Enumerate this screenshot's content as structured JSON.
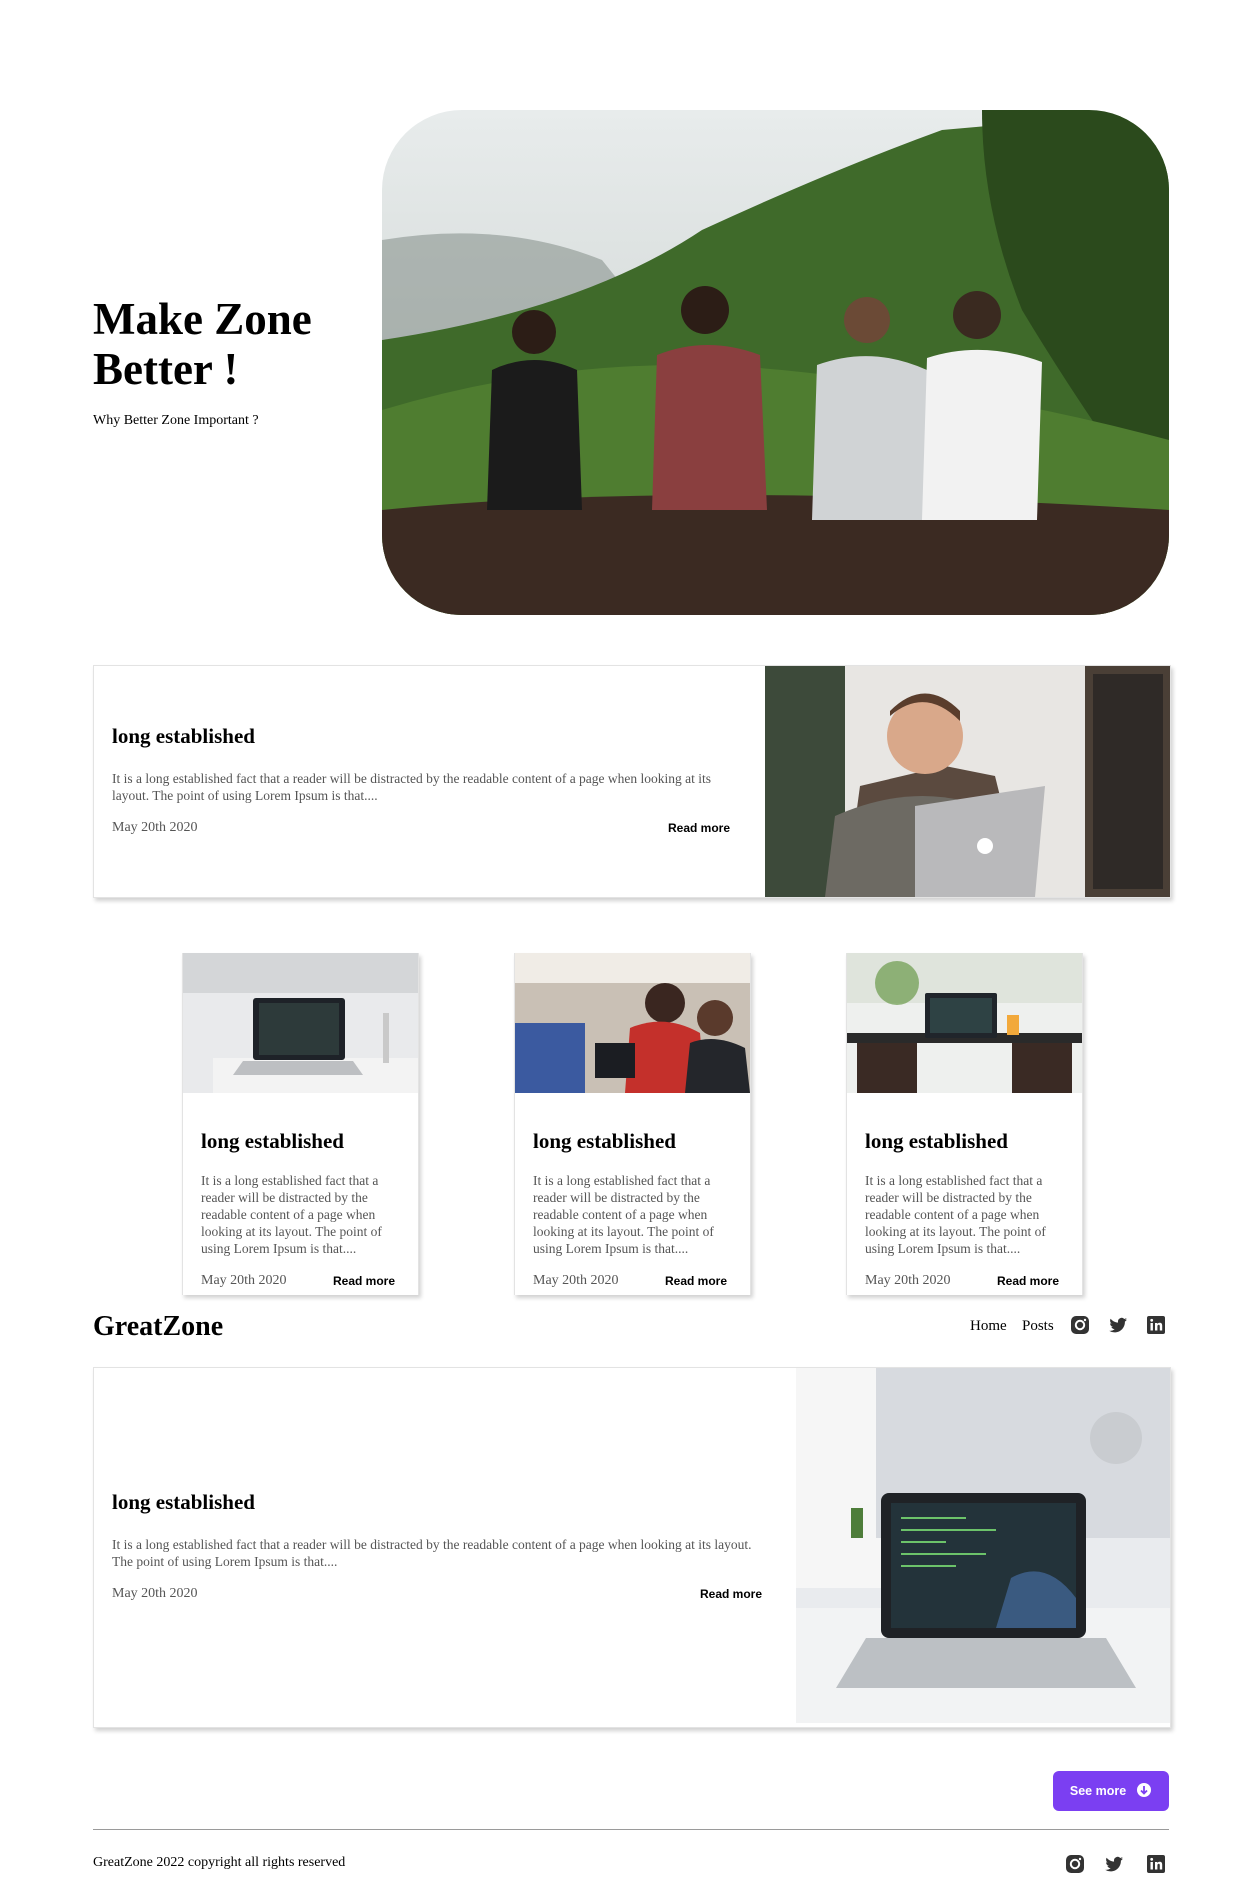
{
  "hero": {
    "title": "Make Zone Better !",
    "subtitle": "Why Better Zone Important ?",
    "image": "group of four men sitting on green mountain ridge"
  },
  "featured_post": {
    "title": "long established",
    "text": "It is a long established fact that a reader will be distracted by the readable content of a page when looking at its layout. The point of using Lorem Ipsum is that....",
    "date": "May 20th 2020",
    "read_more": "Read more",
    "image": "man with beard using laptop"
  },
  "posts": [
    {
      "title": "long established",
      "text": "It is a long established fact that a reader will be distracted by the readable content of a page when looking at its layout. The point of using Lorem Ipsum is that....",
      "date": "May 20th 2020",
      "read_more": "Read more",
      "image": "laptop on white desk"
    },
    {
      "title": "long established",
      "text": "It is a long established fact that a reader will be distracted by the readable content of a page when looking at its layout. The point of using Lorem Ipsum is that....",
      "date": "May 20th 2020",
      "read_more": "Read more",
      "image": "people working together at computer"
    },
    {
      "title": "long established",
      "text": "It is a long established fact that a reader will be distracted by the readable content of a page when looking at its layout. The point of using Lorem Ipsum is that....",
      "date": "May 20th 2020",
      "read_more": "Read more",
      "image": "laptop on table in cafe"
    }
  ],
  "header": {
    "brand": "GreatZone",
    "nav": [
      "Home",
      "Posts"
    ],
    "social": [
      "instagram-icon",
      "twitter-icon",
      "linkedin-icon"
    ]
  },
  "featured_post_2": {
    "title": "long established",
    "text": "It is a long established fact that a reader will be distracted by the readable content of a page when looking at its layout. The point of using Lorem Ipsum is that....",
    "date": "May 20th 2020",
    "read_more": "Read more",
    "image": "laptop showing code on desk"
  },
  "see_more": "See more",
  "footer": {
    "copyright": "GreatZone 2022 copyright all rights reserved",
    "social": [
      "instagram-icon",
      "twitter-icon",
      "linkedin-icon"
    ]
  },
  "colors": {
    "accent": "#7b3ff2"
  }
}
